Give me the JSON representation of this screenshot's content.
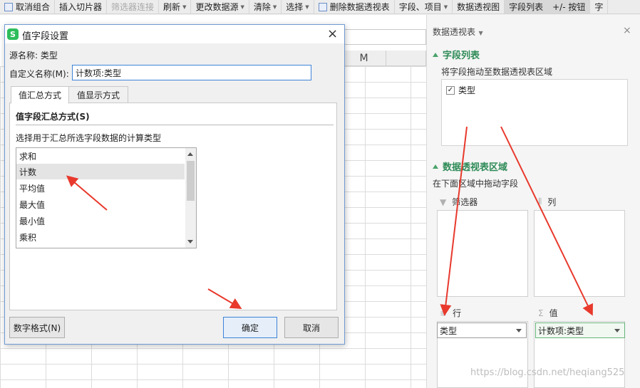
{
  "ribbon": {
    "items": [
      {
        "label": "取消组合",
        "dim": false,
        "caret": false
      },
      {
        "label": "插入切片器",
        "dim": false,
        "caret": false
      },
      {
        "label": "筛选器连接",
        "dim": true,
        "caret": false
      },
      {
        "label": "刷新",
        "dim": false,
        "caret": true
      },
      {
        "label": "更改数据源",
        "dim": false,
        "caret": true
      },
      {
        "label": "清除",
        "dim": false,
        "caret": true
      },
      {
        "label": "选择",
        "dim": false,
        "caret": true
      },
      {
        "label": "删除数据透视表",
        "dim": false,
        "caret": false
      },
      {
        "label": "字段、项目",
        "dim": false,
        "caret": true
      },
      {
        "label": "数据透视图",
        "dim": false,
        "caret": false
      },
      {
        "label": "字段列表",
        "dim": false,
        "caret": false,
        "active": true
      },
      {
        "label": "+/- 按钮",
        "dim": false,
        "caret": false,
        "active": true
      },
      {
        "label": "字",
        "dim": false,
        "caret": false
      }
    ]
  },
  "sheet": {
    "column_header": "M"
  },
  "pane": {
    "title": "数据透视表",
    "close_label": "×",
    "field_list_title": "字段列表",
    "field_list_hint": "将字段拖动至数据透视表区域",
    "fields": [
      {
        "label": "类型",
        "checked": true,
        "check_mark": "✓"
      }
    ],
    "areas_title": "数据透视表区域",
    "areas_hint": "在下面区域中拖动字段",
    "areas": {
      "filter_label": "筛选器",
      "column_label": "列",
      "row_label": "行",
      "value_label": "值",
      "row_item": "类型",
      "value_item": "计数项:类型"
    }
  },
  "dialog": {
    "title": "值字段设置",
    "logo_letter": "S",
    "close_label": "×",
    "source_label": "源名称:",
    "source_value": "类型",
    "custom_name_label": "自定义名称(M):",
    "custom_name_value": "计数项:类型",
    "tabs": [
      {
        "label": "值汇总方式",
        "active": true
      },
      {
        "label": "值显示方式",
        "active": false
      }
    ],
    "group_title": "值字段汇总方式(S)",
    "group_desc": "选择用于汇总所选字段数据的计算类型",
    "functions": [
      "求和",
      "计数",
      "平均值",
      "最大值",
      "最小值",
      "乘积"
    ],
    "selected_function": "计数",
    "number_format_button": "数字格式(N)",
    "ok_button": "确定",
    "cancel_button": "取消"
  },
  "watermark": "https://blog.csdn.net/heqiang525",
  "colors": {
    "accent_green": "#2e8b57",
    "annotation_red": "#e8392c",
    "dialog_border": "#6e9bd4"
  }
}
